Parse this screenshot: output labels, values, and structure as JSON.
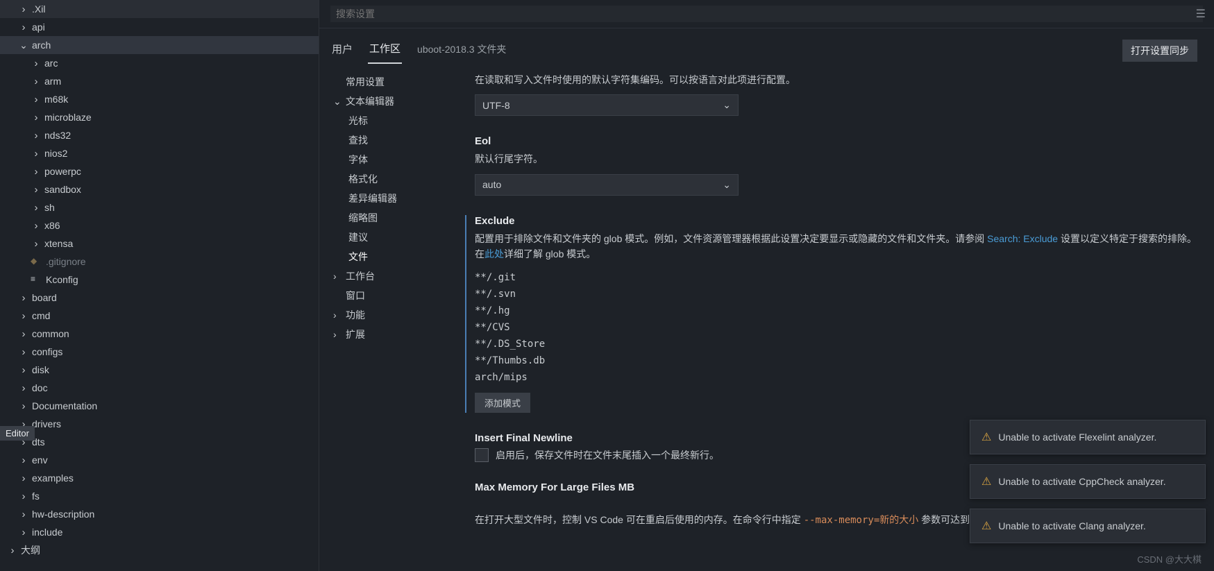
{
  "search": {
    "placeholder": "搜索设置"
  },
  "tabs": {
    "user": "用户",
    "workspace": "工作区",
    "folder": "uboot-2018.3 文件夹"
  },
  "sync_button": "打开设置同步",
  "editor_badge": "Editor",
  "outline": "大纲",
  "sidebar": {
    "items": [
      {
        "label": ".Xil",
        "type": "folder",
        "indent": 1
      },
      {
        "label": "api",
        "type": "folder",
        "indent": 1
      },
      {
        "label": "arch",
        "type": "folder",
        "indent": 1,
        "expanded": true,
        "selected": true
      },
      {
        "label": "arc",
        "type": "folder",
        "indent": 2
      },
      {
        "label": "arm",
        "type": "folder",
        "indent": 2
      },
      {
        "label": "m68k",
        "type": "folder",
        "indent": 2
      },
      {
        "label": "microblaze",
        "type": "folder",
        "indent": 2
      },
      {
        "label": "nds32",
        "type": "folder",
        "indent": 2
      },
      {
        "label": "nios2",
        "type": "folder",
        "indent": 2
      },
      {
        "label": "powerpc",
        "type": "folder",
        "indent": 2
      },
      {
        "label": "sandbox",
        "type": "folder",
        "indent": 2
      },
      {
        "label": "sh",
        "type": "folder",
        "indent": 2
      },
      {
        "label": "x86",
        "type": "folder",
        "indent": 2
      },
      {
        "label": "xtensa",
        "type": "folder",
        "indent": 2
      },
      {
        "label": ".gitignore",
        "type": "file",
        "indent": 2,
        "dim": true
      },
      {
        "label": "Kconfig",
        "type": "file",
        "indent": 2
      },
      {
        "label": "board",
        "type": "folder",
        "indent": 1
      },
      {
        "label": "cmd",
        "type": "folder",
        "indent": 1
      },
      {
        "label": "common",
        "type": "folder",
        "indent": 1
      },
      {
        "label": "configs",
        "type": "folder",
        "indent": 1
      },
      {
        "label": "disk",
        "type": "folder",
        "indent": 1
      },
      {
        "label": "doc",
        "type": "folder",
        "indent": 1
      },
      {
        "label": "Documentation",
        "type": "folder",
        "indent": 1
      },
      {
        "label": "drivers",
        "type": "folder",
        "indent": 1
      },
      {
        "label": "dts",
        "type": "folder",
        "indent": 1
      },
      {
        "label": "env",
        "type": "folder",
        "indent": 1
      },
      {
        "label": "examples",
        "type": "folder",
        "indent": 1
      },
      {
        "label": "fs",
        "type": "folder",
        "indent": 1
      },
      {
        "label": "hw-description",
        "type": "folder",
        "indent": 1
      },
      {
        "label": "include",
        "type": "folder",
        "indent": 1
      }
    ]
  },
  "settings_nav": [
    {
      "label": "常用设置",
      "type": "item"
    },
    {
      "label": "文本编辑器",
      "type": "group",
      "expanded": true
    },
    {
      "label": "光标",
      "type": "sub"
    },
    {
      "label": "查找",
      "type": "sub"
    },
    {
      "label": "字体",
      "type": "sub"
    },
    {
      "label": "格式化",
      "type": "sub"
    },
    {
      "label": "差异编辑器",
      "type": "sub"
    },
    {
      "label": "缩略图",
      "type": "sub"
    },
    {
      "label": "建议",
      "type": "sub"
    },
    {
      "label": "文件",
      "type": "sub",
      "active": true
    },
    {
      "label": "工作台",
      "type": "group"
    },
    {
      "label": "窗口",
      "type": "item"
    },
    {
      "label": "功能",
      "type": "group"
    },
    {
      "label": "扩展",
      "type": "group"
    }
  ],
  "encoding": {
    "desc": "在读取和写入文件时使用的默认字符集编码。可以按语言对此项进行配置。",
    "value": "UTF-8"
  },
  "eol": {
    "title": "Eol",
    "desc": "默认行尾字符。",
    "value": "auto"
  },
  "exclude": {
    "title": "Exclude",
    "desc_before": "配置用于排除文件和文件夹的 glob 模式。例如，文件资源管理器根据此设置决定要显示或隐藏的文件和文件夹。请参阅 ",
    "link1": "Search: Exclude",
    "desc_mid": " 设置以定义特定于搜索的排除。在",
    "link2": "此处",
    "desc_after": "详细了解 glob 模式。",
    "patterns": [
      "**/.git",
      "**/.svn",
      "**/.hg",
      "**/CVS",
      "**/.DS_Store",
      "**/Thumbs.db",
      "arch/mips"
    ],
    "add_button": "添加模式"
  },
  "insert_newline": {
    "title": "Insert Final Newline",
    "desc": "启用后，保存文件时在文件末尾插入一个最终新行。"
  },
  "max_memory": {
    "title": "Max Memory For Large Files MB",
    "desc_before": "在打开大型文件时，控制 VS Code 可在重启后使用的内存。在命令行中指定 ",
    "code": "--max-memory=新的大小",
    "desc_after": " 参数可达到相同效果。"
  },
  "notifications": [
    "Unable to activate Flexelint analyzer.",
    "Unable to activate CppCheck analyzer.",
    "Unable to activate Clang analyzer."
  ],
  "watermark": "CSDN @大大棋"
}
